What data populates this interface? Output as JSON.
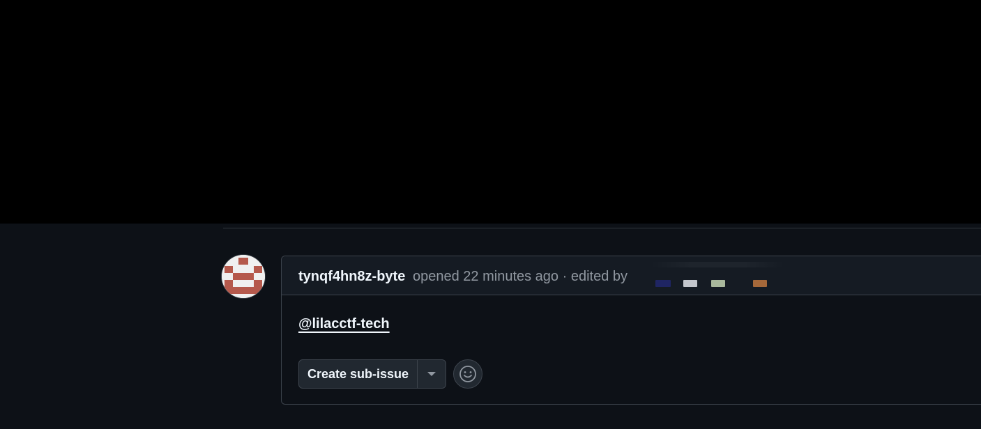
{
  "comment": {
    "author": "tynqf4hn8z-byte",
    "meta_text": "opened 22 minutes ago · edited by",
    "body_mention": "@lilacctf-tech"
  },
  "actions": {
    "create_sub_issue_label": "Create sub-issue",
    "dropdown_icon": "triangle-down-icon",
    "reaction_icon": "smiley-icon"
  },
  "colors": {
    "page_bg": "#0d1117",
    "header_bg": "#151b23",
    "border": "#3d444d",
    "text_primary": "#f0f6fc",
    "text_muted": "#9198a1",
    "avatar_color": "#b5594c"
  }
}
